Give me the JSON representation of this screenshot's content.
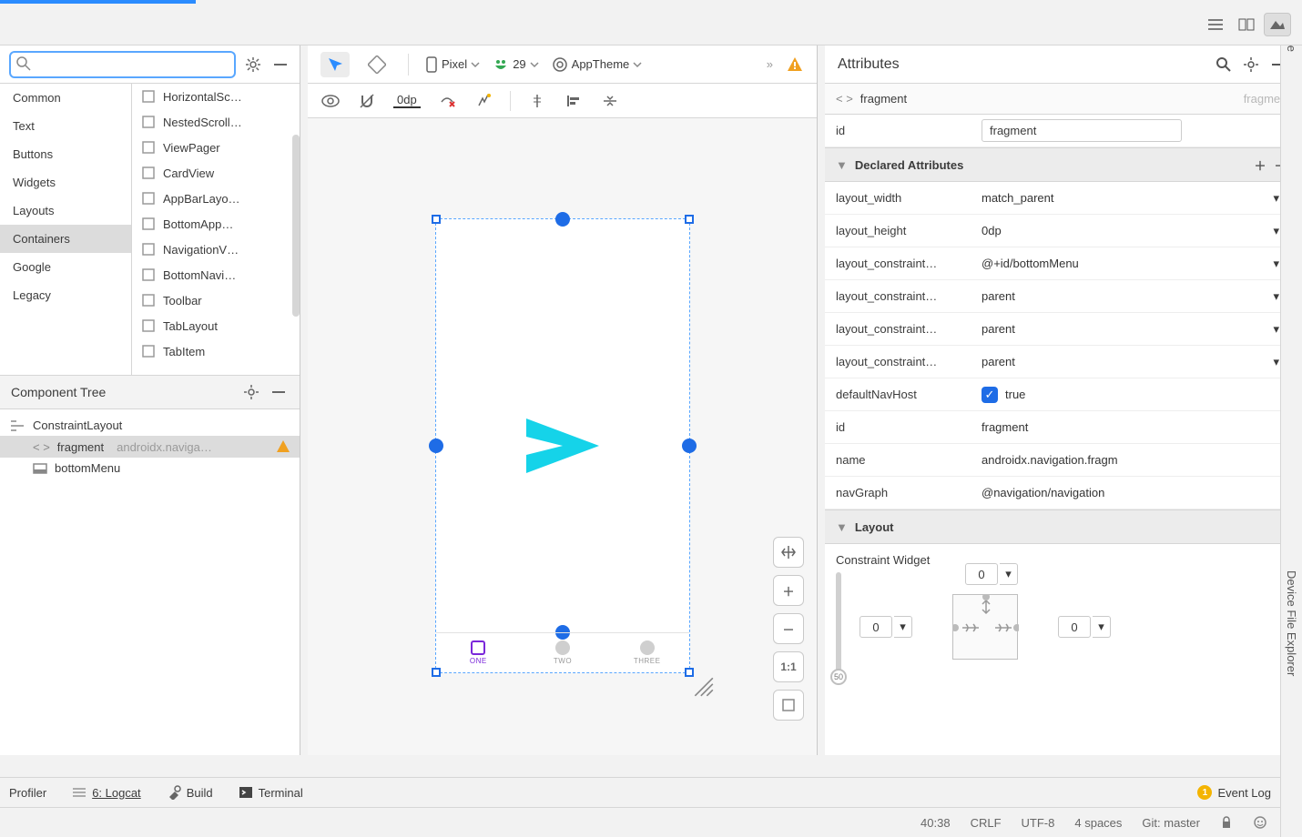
{
  "topbar": {},
  "side_tabs": {
    "gradle": "Gradle",
    "device": "Device File Explorer"
  },
  "palette": {
    "categories": [
      "Common",
      "Text",
      "Buttons",
      "Widgets",
      "Layouts",
      "Containers",
      "Google",
      "Legacy"
    ],
    "selected": "Containers",
    "items": [
      "HorizontalSc…",
      "NestedScroll…",
      "ViewPager",
      "CardView",
      "AppBarLayo…",
      "BottomApp…",
      "NavigationV…",
      "BottomNavi…",
      "Toolbar",
      "TabLayout",
      "TabItem"
    ]
  },
  "ctree": {
    "title": "Component Tree",
    "nodes": [
      {
        "label": "ConstraintLayout",
        "type": "root"
      },
      {
        "label": "fragment",
        "hint": "androidx.naviga…",
        "type": "node",
        "selected": true,
        "warn": true
      },
      {
        "label": "bottomMenu",
        "type": "node"
      }
    ]
  },
  "design_toolbar": {
    "device": "Pixel",
    "api": "29",
    "theme": "AppTheme",
    "default": "0dp"
  },
  "preview": {
    "nav": [
      "ONE",
      "TWO",
      "THREE"
    ]
  },
  "attributes": {
    "title": "Attributes",
    "path_tag": "fragment",
    "path_hint": "fragment",
    "id_label": "id",
    "id_value": "fragment",
    "section_declared": "Declared Attributes",
    "rows": [
      {
        "k": "layout_width",
        "v": "match_parent",
        "drop": true
      },
      {
        "k": "layout_height",
        "v": "0dp",
        "drop": true
      },
      {
        "k": "layout_constraint…",
        "v": "@+id/bottomMenu",
        "drop": true
      },
      {
        "k": "layout_constraint…",
        "v": "parent",
        "drop": true
      },
      {
        "k": "layout_constraint…",
        "v": "parent",
        "drop": true
      },
      {
        "k": "layout_constraint…",
        "v": "parent",
        "drop": true
      },
      {
        "k": "defaultNavHost",
        "v": "true",
        "check": true
      },
      {
        "k": "id",
        "v": "fragment"
      },
      {
        "k": "name",
        "v": "androidx.navigation.fragm"
      },
      {
        "k": "navGraph",
        "v": "@navigation/navigation",
        "scroll": true
      }
    ],
    "section_layout": "Layout",
    "cw_title": "Constraint Widget",
    "cw": {
      "top": "0",
      "left": "0",
      "right": "0",
      "bias": "50"
    }
  },
  "bottom": {
    "profiler": "Profiler",
    "logcat": "6: Logcat",
    "build": "Build",
    "terminal": "Terminal",
    "eventlog": "Event Log"
  },
  "status": {
    "caret": "40:38",
    "sep": "CRLF",
    "enc": "UTF-8",
    "indent": "4 spaces",
    "git": "Git: master"
  }
}
